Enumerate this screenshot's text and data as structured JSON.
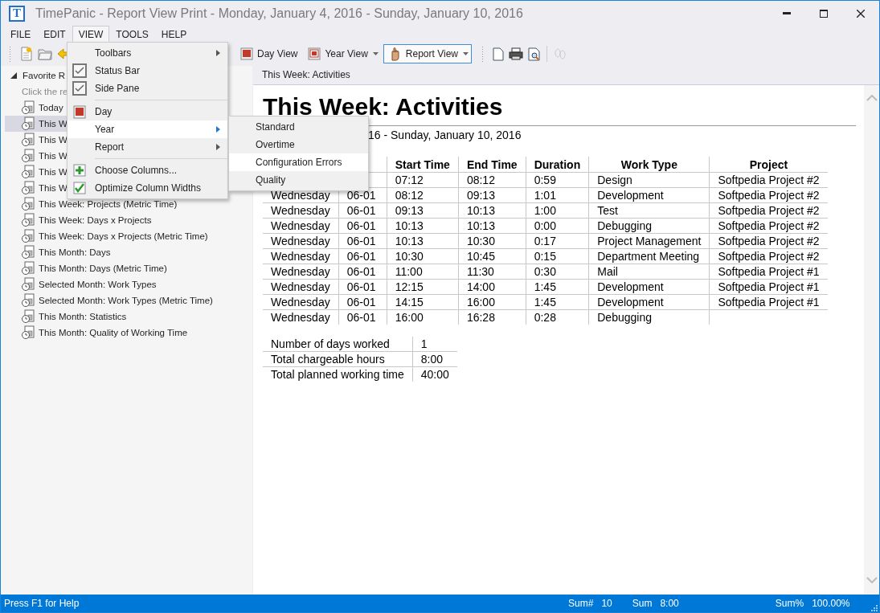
{
  "window": {
    "app_letter": "T",
    "title": "TimePanic - Report View Print - Monday, January 4, 2016 - Sunday, January 10, 2016"
  },
  "menubar": [
    {
      "label": "FILE",
      "selected": false
    },
    {
      "label": "EDIT",
      "selected": false
    },
    {
      "label": "VIEW",
      "selected": true
    },
    {
      "label": "TOOLS",
      "selected": false
    },
    {
      "label": "HELP",
      "selected": false
    }
  ],
  "toolbar": {
    "left_tools": [
      {
        "kind": "newdoc"
      },
      {
        "kind": "folder"
      },
      {
        "kind": "arrow"
      }
    ],
    "view_buttons": [
      {
        "label": "Day View",
        "kind": "day",
        "dropdown": false,
        "selected": false
      },
      {
        "label": "Year View",
        "kind": "year",
        "dropdown": true,
        "selected": false
      },
      {
        "label": "Report View",
        "kind": "report",
        "dropdown": true,
        "selected": true
      }
    ],
    "print_tools": [
      {
        "kind": "page",
        "disabled": false
      },
      {
        "kind": "printer",
        "disabled": false
      },
      {
        "kind": "preview",
        "disabled": false
      }
    ],
    "extra_tools": [
      {
        "kind": "footprints",
        "disabled": true
      }
    ]
  },
  "sidebar": {
    "header": "Favorite R",
    "expanded": true,
    "hint": "Click the re",
    "items": [
      {
        "label": "Today",
        "selected": false
      },
      {
        "label": "This W",
        "selected": true
      },
      {
        "label": "This W",
        "selected": false
      },
      {
        "label": "This W",
        "selected": false
      },
      {
        "label": "This W",
        "selected": false
      },
      {
        "label": "This W",
        "selected": false
      },
      {
        "label": "This Week: Projects (Metric Time)",
        "selected": false
      },
      {
        "label": "This Week: Days x Projects",
        "selected": false
      },
      {
        "label": "This Week: Days x Projects (Metric Time)",
        "selected": false
      },
      {
        "label": "This Month: Days",
        "selected": false
      },
      {
        "label": "This Month: Days (Metric Time)",
        "selected": false
      },
      {
        "label": "Selected Month: Work Types",
        "selected": false
      },
      {
        "label": "Selected Month: Work Types (Metric Time)",
        "selected": false
      },
      {
        "label": "This Month: Statistics",
        "selected": false
      },
      {
        "label": "This Month: Quality of Working Time",
        "selected": false
      }
    ]
  },
  "report": {
    "tab_title": "This Week: Activities",
    "title": "This Week: Activities",
    "date_range": "16 - Sunday, January 10, 2016",
    "table": {
      "columns": [
        null,
        null,
        "Start Time",
        "End Time",
        "Duration",
        "Work Type",
        "Project"
      ],
      "rows": [
        [
          null,
          null,
          "07:12",
          "08:12",
          "0:59",
          "Design",
          "Softpedia Project #2"
        ],
        [
          "Wednesday",
          "06-01",
          "08:12",
          "09:13",
          "1:01",
          "Development",
          "Softpedia Project #2"
        ],
        [
          "Wednesday",
          "06-01",
          "09:13",
          "10:13",
          "1:00",
          "Test",
          "Softpedia Project #2"
        ],
        [
          "Wednesday",
          "06-01",
          "10:13",
          "10:13",
          "0:00",
          "Debugging",
          "Softpedia Project #2"
        ],
        [
          "Wednesday",
          "06-01",
          "10:13",
          "10:30",
          "0:17",
          "Project Management",
          "Softpedia Project #2"
        ],
        [
          "Wednesday",
          "06-01",
          "10:30",
          "10:45",
          "0:15",
          "Department Meeting",
          "Softpedia Project #2"
        ],
        [
          "Wednesday",
          "06-01",
          "11:00",
          "11:30",
          "0:30",
          "Mail",
          "Softpedia Project #1"
        ],
        [
          "Wednesday",
          "06-01",
          "12:15",
          "14:00",
          "1:45",
          "Development",
          "Softpedia Project #1"
        ],
        [
          "Wednesday",
          "06-01",
          "14:15",
          "16:00",
          "1:45",
          "Development",
          "Softpedia Project #1"
        ],
        [
          "Wednesday",
          "06-01",
          "16:00",
          "16:28",
          "0:28",
          "Debugging",
          null
        ]
      ]
    },
    "summary": [
      {
        "label": "Number of days worked",
        "value": "1"
      },
      {
        "label": "Total chargeable hours",
        "value": "8:00"
      },
      {
        "label": "Total planned working time",
        "value": "40:00"
      }
    ]
  },
  "view_menu": [
    {
      "kind": "submenu",
      "label": "Toolbars",
      "selected": false
    },
    {
      "kind": "check",
      "label": "Status Bar",
      "checked": true,
      "selected": false
    },
    {
      "kind": "check",
      "label": "Side Pane",
      "checked": true,
      "selected": false
    },
    {
      "kind": "separator"
    },
    {
      "kind": "calendar",
      "label": "Day",
      "selected": false
    },
    {
      "kind": "submenu",
      "label": "Year",
      "selected": true
    },
    {
      "kind": "submenu",
      "label": "Report",
      "selected": false
    },
    {
      "kind": "separator"
    },
    {
      "kind": "addcolumn",
      "label": "Choose Columns...",
      "selected": false
    },
    {
      "kind": "fitcolumns",
      "label": "Optimize Column Widths",
      "selected": false
    }
  ],
  "year_submenu": [
    {
      "label": "Standard",
      "selected": false
    },
    {
      "label": "Overtime",
      "selected": false
    },
    {
      "label": "Configuration Errors",
      "selected": true
    },
    {
      "label": "Quality",
      "selected": false
    }
  ],
  "status_bar": {
    "help": "Press F1 for Help",
    "fields": [
      {
        "label": "Sum#",
        "value": "10"
      },
      {
        "label": "Sum",
        "value": "8:00"
      },
      {
        "label": "Sum%",
        "value": "100.00%"
      }
    ]
  }
}
